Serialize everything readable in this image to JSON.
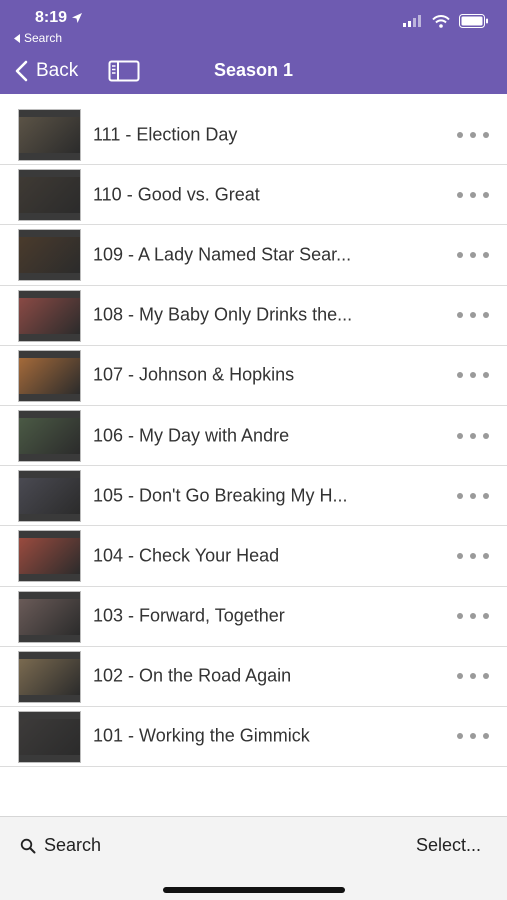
{
  "status_bar": {
    "time": "8:19",
    "back_to_app": "Search",
    "location_icon": "location-arrow-icon",
    "signal_icon": "cellular-signal-icon",
    "wifi_icon": "wifi-icon",
    "battery_icon": "battery-icon"
  },
  "nav": {
    "back_label": "Back",
    "title": "Season 1",
    "sidebar_icon": "sidebar-icon"
  },
  "episodes": [
    {
      "title": "111 - Election Day",
      "thumb_color": "#5b5346"
    },
    {
      "title": "110 - Good vs. Great",
      "thumb_color": "#3f3a34"
    },
    {
      "title": "109 - A Lady Named Star Sear...",
      "thumb_color": "#4a3b2c"
    },
    {
      "title": "108 - My Baby Only Drinks the...",
      "thumb_color": "#8a4a45"
    },
    {
      "title": "107 - Johnson & Hopkins",
      "thumb_color": "#a46a3a"
    },
    {
      "title": "106 - My Day with Andre",
      "thumb_color": "#4b5a45"
    },
    {
      "title": "105 - Don't Go Breaking My H...",
      "thumb_color": "#4a4a52"
    },
    {
      "title": "104 - Check Your Head",
      "thumb_color": "#9a4b3f"
    },
    {
      "title": "103 - Forward, Together",
      "thumb_color": "#6a5b58"
    },
    {
      "title": "102 - On the Road Again",
      "thumb_color": "#7a6a50"
    },
    {
      "title": "101 - Working the Gimmick",
      "thumb_color": "#3d3b3a"
    }
  ],
  "toolbar": {
    "search_label": "Search",
    "select_label": "Select...",
    "search_icon": "magnifier-icon"
  },
  "colors": {
    "header_bg": "#6e5bb1",
    "more_dots": "#9a9a9a"
  }
}
